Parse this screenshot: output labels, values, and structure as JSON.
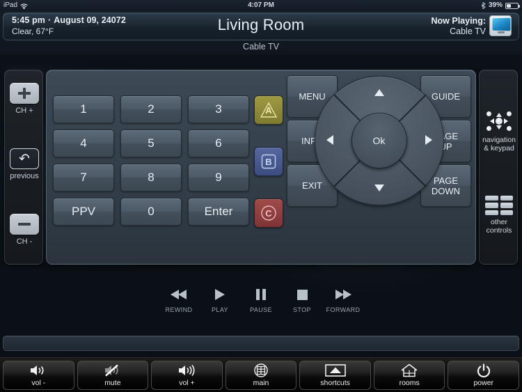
{
  "statusbar": {
    "device": "iPad",
    "wifi_icon": "wifi-icon",
    "time": "4:07 PM",
    "bluetooth_icon": "bluetooth-icon",
    "battery_percent": "39%"
  },
  "header": {
    "clock": "5:45 pm",
    "separator": "·",
    "date": "August 09, 24072",
    "weather": "Clear, 67°F",
    "room_title": "Living Room",
    "now_playing_label": "Now Playing:",
    "now_playing_value": "Cable TV",
    "source_subtitle": "Cable TV",
    "tv_icon": "tv-icon"
  },
  "left_rail": {
    "items": [
      {
        "label": "CH +",
        "icon": "plus-icon"
      },
      {
        "label": "previous",
        "icon": "back-arrow-icon"
      },
      {
        "label": "CH -",
        "icon": "minus-icon"
      }
    ]
  },
  "right_rail": {
    "items": [
      {
        "label_line1": "navigation",
        "label_line2": "& keypad",
        "icon": "dpad-icon"
      },
      {
        "label_line1": "other",
        "label_line2": "controls",
        "icon": "grid-icon"
      }
    ]
  },
  "keypad": {
    "keys": [
      "1",
      "2",
      "3",
      "4",
      "5",
      "6",
      "7",
      "8",
      "9",
      "PPV",
      "0",
      "Enter"
    ]
  },
  "color_buttons": [
    {
      "label": "A",
      "shape": "triangle-icon",
      "color": "#8a8638"
    },
    {
      "label": "B",
      "shape": "square-icon",
      "color": "#46568d"
    },
    {
      "label": "C",
      "shape": "circle-icon",
      "color": "#8e3f3f"
    }
  ],
  "navigation": {
    "menu": "MENU",
    "guide": "GUIDE",
    "info": "INFO",
    "page_up": "PAGE\nUP",
    "page_up_l1": "PAGE",
    "page_up_l2": "UP",
    "exit": "EXIT",
    "page_down_l1": "PAGE",
    "page_down_l2": "DOWN",
    "ok": "Ok",
    "up_icon": "arrow-up-icon",
    "down_icon": "arrow-down-icon",
    "left_icon": "arrow-left-icon",
    "right_icon": "arrow-right-icon"
  },
  "transport": [
    {
      "label": "REWIND",
      "icon": "rewind-icon"
    },
    {
      "label": "PLAY",
      "icon": "play-icon"
    },
    {
      "label": "PAUSE",
      "icon": "pause-icon"
    },
    {
      "label": "STOP",
      "icon": "stop-icon"
    },
    {
      "label": "FORWARD",
      "icon": "fast-forward-icon"
    }
  ],
  "toolbar": [
    {
      "label": "vol -",
      "icon": "volume-down-icon"
    },
    {
      "label": "mute",
      "icon": "volume-mute-icon"
    },
    {
      "label": "vol +",
      "icon": "volume-up-icon"
    },
    {
      "label": "main",
      "icon": "grid-circle-icon"
    },
    {
      "label": "shortcuts",
      "icon": "chevron-up-box-icon"
    },
    {
      "label": "rooms",
      "icon": "house-icon"
    },
    {
      "label": "power",
      "icon": "power-icon"
    }
  ],
  "colors": {
    "panel": "#36424d",
    "button": "#4c5966",
    "accent_blue": "#2b8fc6",
    "rail": "#191d22",
    "toolbar": "#0a0a0a"
  }
}
